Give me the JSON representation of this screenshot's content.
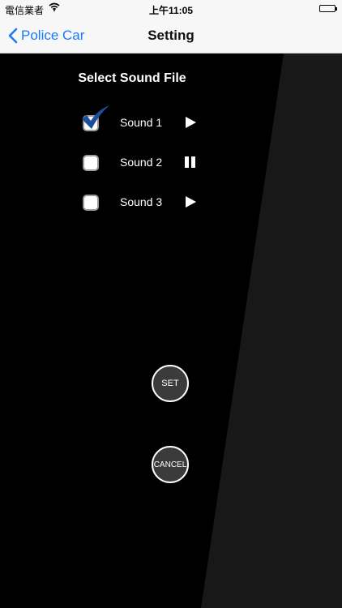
{
  "status_bar": {
    "carrier": "電信業者",
    "time": "上午11:05"
  },
  "nav": {
    "back_label": "Police Car",
    "title": "Setting"
  },
  "settings": {
    "section_title": "Select Sound File",
    "sounds": [
      {
        "label": "Sound 1",
        "checked": true,
        "control": "play-icon"
      },
      {
        "label": "Sound 2",
        "checked": false,
        "control": "pause-icon"
      },
      {
        "label": "Sound 3",
        "checked": false,
        "control": "play-icon"
      }
    ]
  },
  "buttons": {
    "set": "SET",
    "cancel": "CANCEL"
  },
  "colors": {
    "accent": "#1a7cf4",
    "nav_bg": "#f7f7f7",
    "background": "#000000",
    "checkmark": "#1c4e9c"
  }
}
